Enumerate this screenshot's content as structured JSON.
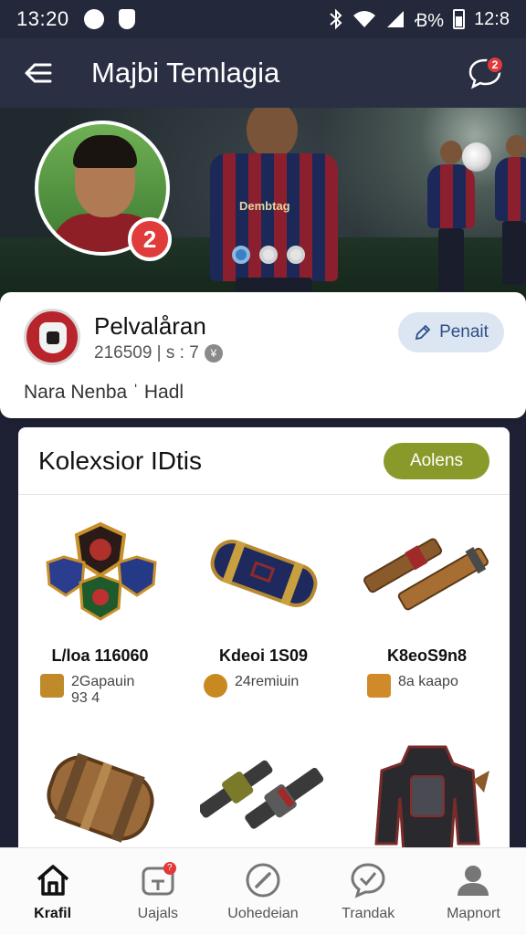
{
  "status_bar": {
    "time_left": "13:20",
    "battery_text": "Ꞗ%",
    "time_right": "12:8"
  },
  "header": {
    "title": "Majbi Temlagia",
    "notification_count": "2"
  },
  "hero": {
    "level_badge": "2",
    "jersey_text": "Dembtag",
    "carousel_dots": 3,
    "carousel_active_index": 0
  },
  "profile": {
    "name": "Pelvalåran",
    "stats": "216509 | s : 7",
    "subtitle": "Nara Nenba ˈ Hadl",
    "edit_label": "Penait"
  },
  "collection": {
    "title": "Kolexsior IDtis",
    "see_all_label": "Aolens",
    "items": [
      {
        "name": "L/loa 116060",
        "meta_line1": "2Gapauin",
        "meta_line2": "93 4",
        "icon": "badge-set-icon"
      },
      {
        "name": "Kdeoi 1S09",
        "meta_line1": "24remiuin",
        "meta_line2": "",
        "icon": "cannon-scroll-icon"
      },
      {
        "name": "K8eoS9n8",
        "meta_line1": "8a kaapo",
        "meta_line2": "",
        "icon": "twin-rods-icon"
      },
      {
        "name": "",
        "meta_line1": "",
        "meta_line2": "",
        "icon": "barrel-icon"
      },
      {
        "name": "",
        "meta_line1": "",
        "meta_line2": "",
        "icon": "twin-cannons-icon"
      },
      {
        "name": "",
        "meta_line1": "",
        "meta_line2": "",
        "icon": "armor-icon"
      }
    ]
  },
  "bottom_nav": {
    "items": [
      {
        "label": "Krafil",
        "icon": "home-icon",
        "active": true
      },
      {
        "label": "Uajals",
        "icon": "inbox-icon",
        "badge": "?"
      },
      {
        "label": "Uohedeian",
        "icon": "edit-icon"
      },
      {
        "label": "Trandak",
        "icon": "chat-check-icon"
      },
      {
        "label": "Mapnort",
        "icon": "profile-icon"
      }
    ]
  },
  "colors": {
    "header_bg": "#2a2f44",
    "accent_green": "#8a9a2a",
    "badge_red": "#e03a3a",
    "edit_button_bg": "#dce6f2"
  }
}
